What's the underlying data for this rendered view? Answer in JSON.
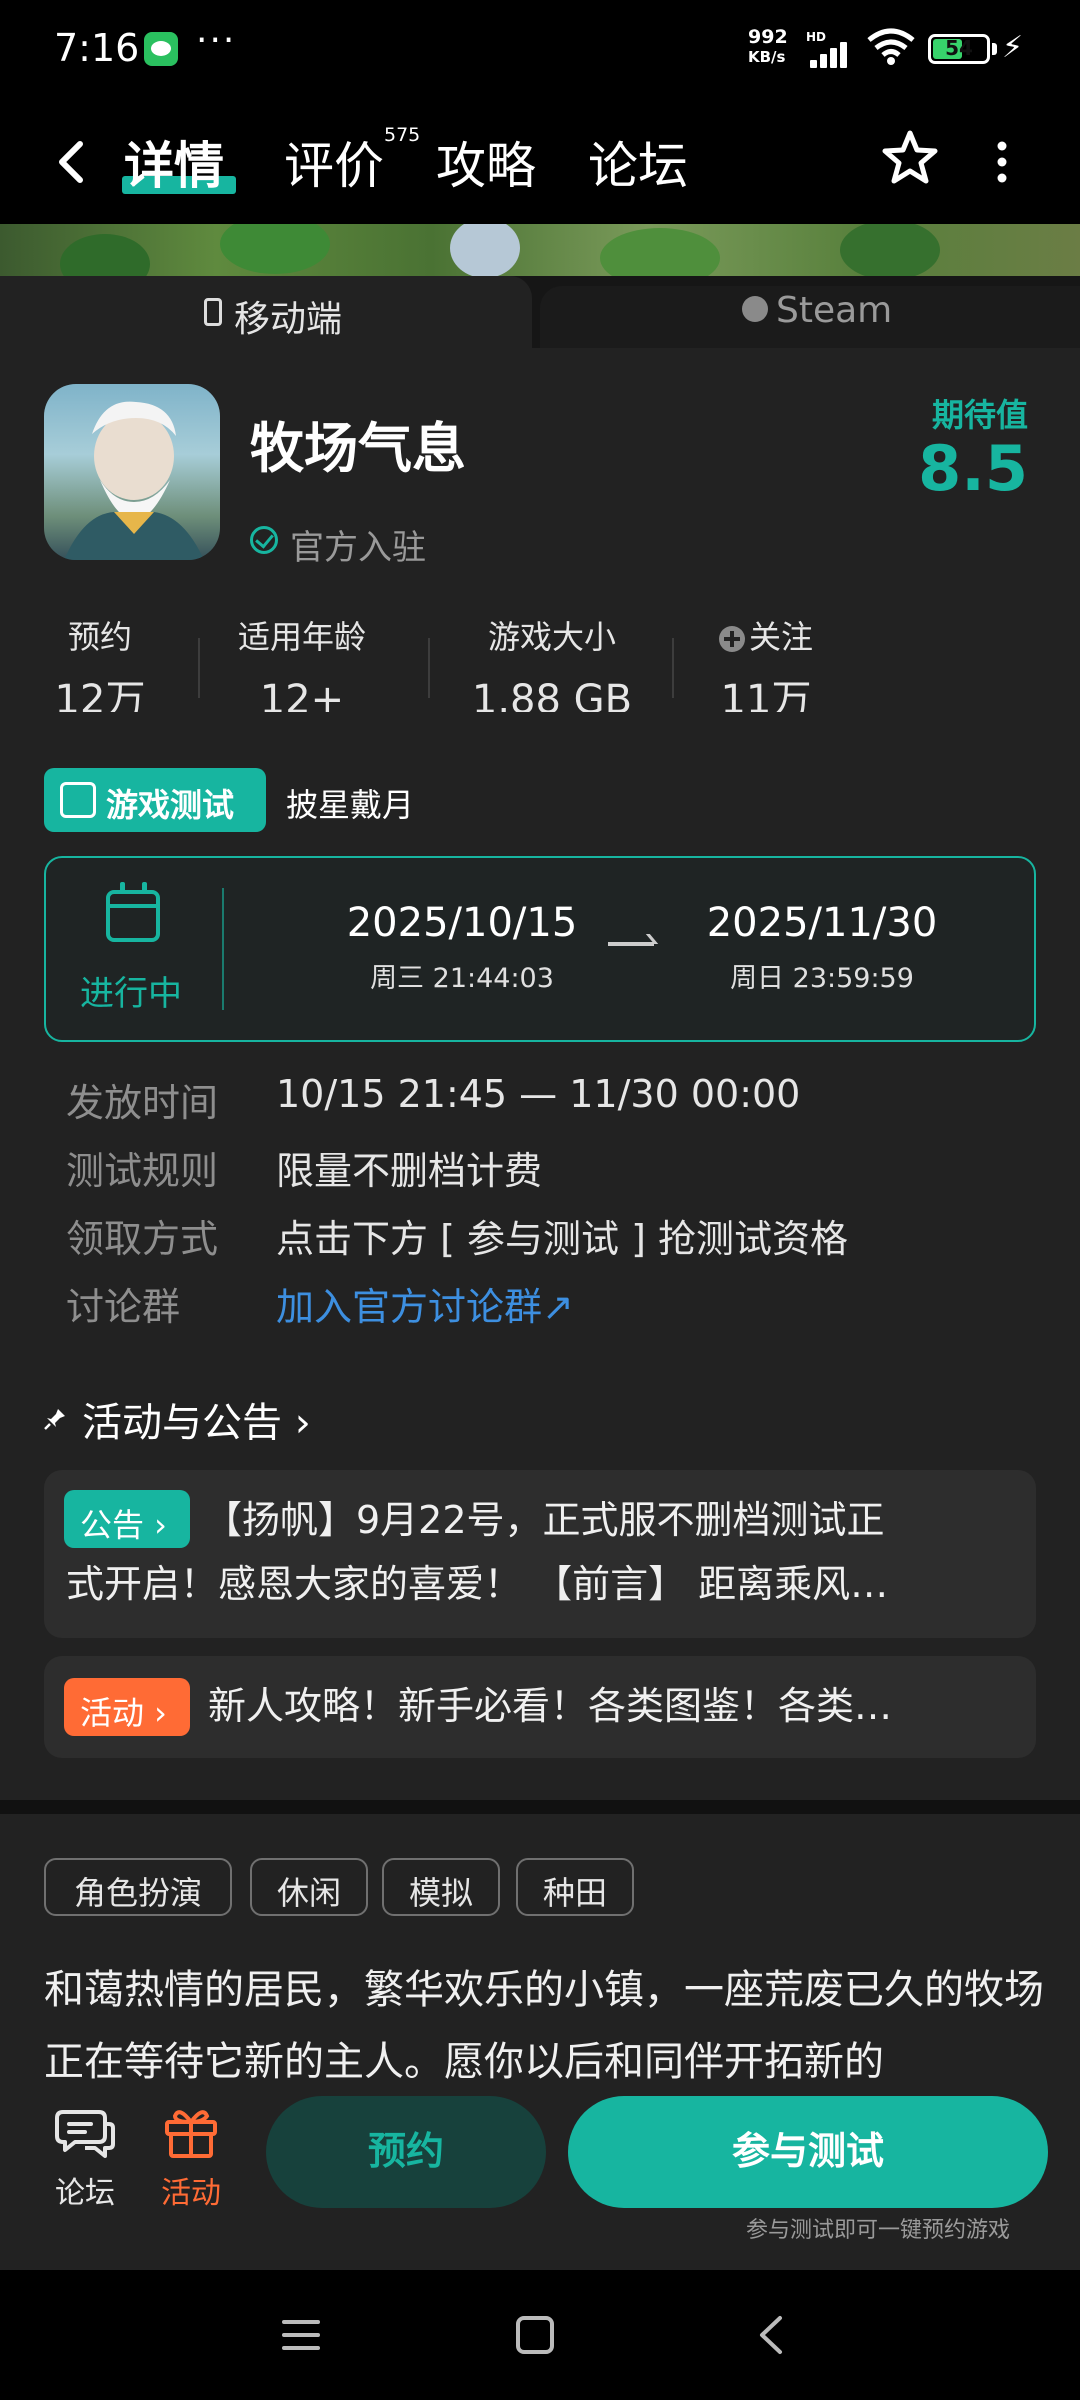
{
  "status_bar": {
    "time": "7:16",
    "more": "···",
    "net_speed_value": "992",
    "net_speed_unit": "KB/s",
    "hd": "HD",
    "battery": "54"
  },
  "nav": {
    "tabs": [
      {
        "label": "详情",
        "active": true
      },
      {
        "label": "评价",
        "badge": "575"
      },
      {
        "label": "攻略"
      },
      {
        "label": "论坛"
      }
    ]
  },
  "platforms": {
    "mobile": "移动端",
    "steam": "Steam"
  },
  "game": {
    "name": "牧场气息",
    "verified": "官方入驻",
    "expect_label": "期待值",
    "expect_score": "8.5"
  },
  "stats": [
    {
      "label": "预约",
      "value": "12万"
    },
    {
      "label": "适用年龄",
      "value": "12+"
    },
    {
      "label": "游戏大小",
      "value": "1.88 GB"
    },
    {
      "label": "关注",
      "value": "11万"
    }
  ],
  "test": {
    "badge": "游戏测试",
    "name": "披星戴月",
    "status": "进行中",
    "start_date": "2025/10/15",
    "start_time": "周三  21:44:03",
    "end_date": "2025/11/30",
    "end_time": "周日  23:59:59"
  },
  "info": [
    {
      "key": "发放时间",
      "value": "10/15 21:45 — 11/30 00:00"
    },
    {
      "key": "测试规则",
      "value": "限量不删档计费"
    },
    {
      "key": "领取方式",
      "value": "点击下方 [ 参与测试 ] 抢测试资格"
    },
    {
      "key": "讨论群",
      "value": "加入官方讨论群↗"
    }
  ],
  "activities": {
    "title": "活动与公告 ›",
    "announcement": {
      "tag": "公告 ›",
      "line1": "【扬帆】9月22号，正式服不删档测试正",
      "line2": "式开启！感恩大家的喜爱！ 【前言】 距离乘风…"
    },
    "event": {
      "tag": "活动 ›",
      "text": "新人攻略！新手必看！各类图鉴！各类…"
    }
  },
  "genres": [
    "角色扮演",
    "休闲",
    "模拟",
    "种田"
  ],
  "description": "和蔼热情的居民，繁华欢乐的小镇，一座荒废已久的牧场正在等待它新的主人。愿你以后和同伴开拓新的",
  "action_bar": {
    "forum": "论坛",
    "activity": "活动",
    "reserve": "预约",
    "join_test": "参与测试",
    "join_hint": "参与测试即可一键预约游戏"
  },
  "colors": {
    "accent": "#17b5a0",
    "activity_orange": "#ff6b35",
    "link_blue": "#3d8fe0",
    "background": "#222222"
  }
}
